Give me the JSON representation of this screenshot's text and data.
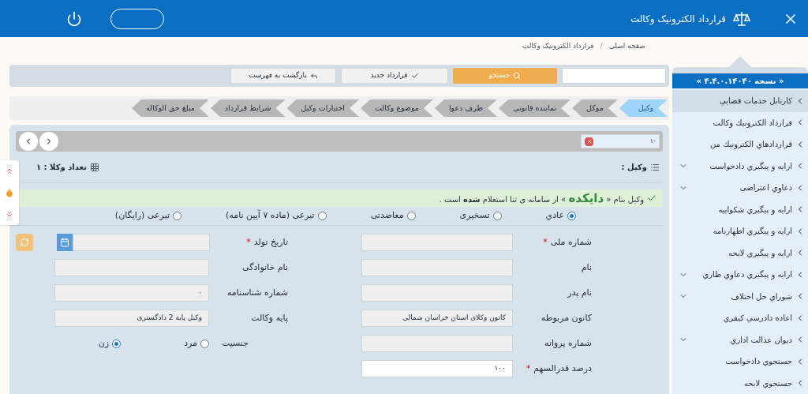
{
  "header": {
    "title": "قرارداد الکترونیک وکالت"
  },
  "breadcrumb": [
    {
      "label": "صفحه اصلی"
    },
    {
      "label": "قرارداد الکترونیک وکالت"
    }
  ],
  "breadcrumb_separator": "/",
  "sidebar": {
    "version": "« نسخه ۴.۴.۰.۱۴۰۴۰ »",
    "items": [
      {
        "label": "کارتابل خدمات قضايي",
        "selected": true,
        "expandable": false
      },
      {
        "label": "قرارداد الکترونيك وكالت",
        "selected": false,
        "expandable": false
      },
      {
        "label": "قراردادهاي الکترونيك من",
        "selected": false,
        "expandable": false
      },
      {
        "label": "ارايه و پيگيري دادخواست",
        "selected": false,
        "expandable": true
      },
      {
        "label": "دعاوي اعتراضي",
        "selected": false,
        "expandable": true
      },
      {
        "label": "ارايه و پيگيري شکواييه",
        "selected": false,
        "expandable": false
      },
      {
        "label": "ارايه و پيگيري اظهارنامه",
        "selected": false,
        "expandable": false
      },
      {
        "label": "ارايه و پيگيري لايحه",
        "selected": false,
        "expandable": false
      },
      {
        "label": "ارايه و پيگيري دعاوي طاري",
        "selected": false,
        "expandable": true
      },
      {
        "label": "شوراي حل اختلاف",
        "selected": false,
        "expandable": true
      },
      {
        "label": "اعاده دادرسي کيفري",
        "selected": false,
        "expandable": false
      },
      {
        "label": "ديوان عدالت اداري",
        "selected": false,
        "expandable": true
      },
      {
        "label": "جستجوي دادخواست",
        "selected": false,
        "expandable": false
      },
      {
        "label": "جستجوي لايحه",
        "selected": false,
        "expandable": false
      }
    ]
  },
  "toolbar": {
    "search_button": "جستجو",
    "new_button": "قرارداد جدید",
    "back_button": "بازگشت به فهرست"
  },
  "steps": [
    {
      "label": "وکیل",
      "selected": true
    },
    {
      "label": "موکل",
      "selected": false
    },
    {
      "label": "نماینده قانونی",
      "selected": false
    },
    {
      "label": "طرف دعوا",
      "selected": false
    },
    {
      "label": "موضوع وکالت",
      "selected": false
    },
    {
      "label": "اختیارات وکیل",
      "selected": false
    },
    {
      "label": "شرایط قرارداد",
      "selected": false
    },
    {
      "label": "مبلغ حق الوکاله",
      "selected": false
    }
  ],
  "lawyer_chip": "-۱",
  "section": {
    "title": "وکیل :",
    "count": "تعداد وکلا : ۱"
  },
  "alert": {
    "prefix": "وکیل بنام «",
    "name": "دایکده",
    "suffix": "» از سامانه ی ثنا استعلام **شده** است ."
  },
  "lawyer_types": [
    {
      "label": "عادي",
      "selected": true
    },
    {
      "label": "تسخیری",
      "selected": false
    },
    {
      "label": "معاضدتی",
      "selected": false
    },
    {
      "label": "تبرعی (ماده ۷ آیین نامه)",
      "selected": false
    },
    {
      "label": "تبرعی (رایگان)",
      "selected": false
    }
  ],
  "fields_right": [
    {
      "label": "شماره ملی",
      "required_mark": "*",
      "white": false
    },
    {
      "label": "نام",
      "white": false
    },
    {
      "label": "نام پدر",
      "white": false
    },
    {
      "label": "کانون مربوطه",
      "value": "کانون وکلای استان خراسان شمالی",
      "white": false
    },
    {
      "label": "شماره پروانه",
      "white": false
    },
    {
      "label": "درصد قدرالسهم",
      "required_mark": "*",
      "value": "۱۰۰",
      "white": true
    }
  ],
  "fields_left": [
    {
      "label": "تاریخ تولد",
      "required_mark": "*",
      "kind": "date"
    },
    {
      "label": "نام خانوادگی",
      "kind": "text"
    },
    {
      "label": "شماره شناسنامه",
      "kind": "text",
      "value": "۰"
    },
    {
      "label": "پایه وکالت",
      "kind": "text",
      "value": "وکیل پایه 2 دادگستری"
    },
    {
      "label": "جنسیت",
      "kind": "gender",
      "options": [
        {
          "label": "مرد",
          "selected": false
        },
        {
          "label": "زن",
          "selected": true
        }
      ]
    }
  ]
}
